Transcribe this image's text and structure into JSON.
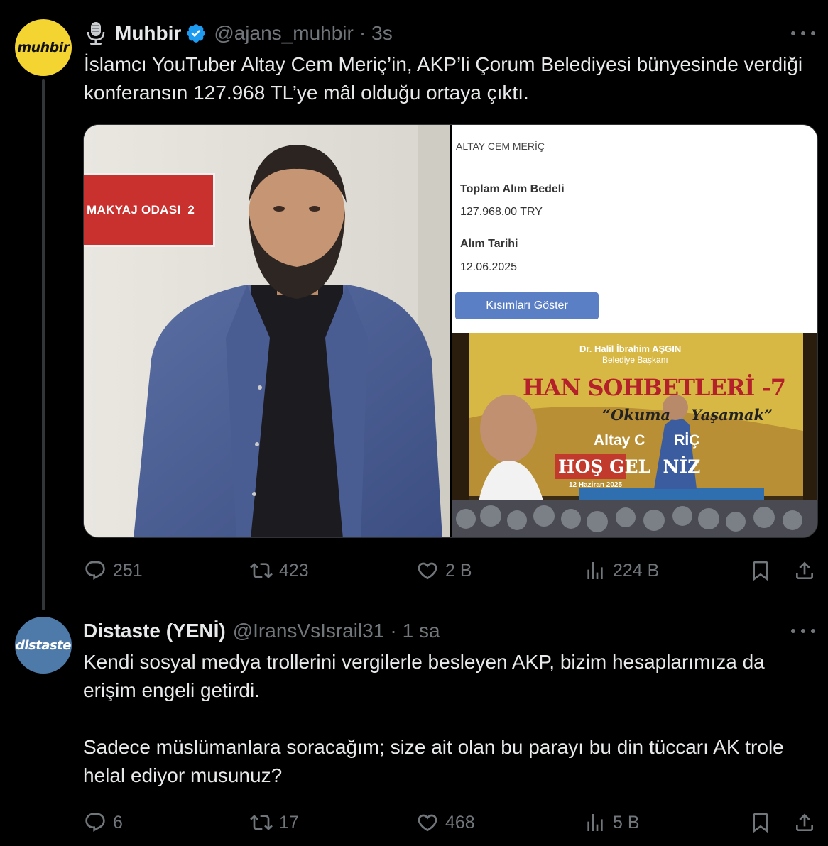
{
  "tweets": [
    {
      "avatar_text": "muhbir",
      "display_name": "Muhbir",
      "handle": "@ajans_muhbir",
      "separator": "·",
      "time": "3s",
      "text": "İslamcı YouTuber Altay Cem Meriç’in, AKP’li Çorum Belediyesi bünyesinde verdiği konferansın 127.968 TL’ye mâl olduğu ortaya çıktı.",
      "media": {
        "left_photo_sign": "MAKYAJ ODASI  2",
        "doc_header": "ALTAY CEM MERİÇ",
        "field1_label": "Toplam Alım Bedeli",
        "field1_value": "127.968,00 TRY",
        "field2_label": "Alım Tarihi",
        "field2_value": "12.06.2025",
        "button_label": "Kısımları Göster",
        "event_host": "Dr. Halil İbrahim AŞGIN",
        "event_host_title": "Belediye Başkanı",
        "event_title": "HAN SOHBETLERİ -7",
        "event_subtitle": "“Okuma    Yaşamak”",
        "event_speaker": "Altay C       RİÇ",
        "event_welcome": "HOŞ GEL  NİZ",
        "event_date": "12 Haziran 2025"
      },
      "stats": {
        "replies": "251",
        "reposts": "423",
        "likes": "2 B",
        "views": "224 B"
      }
    },
    {
      "avatar_text": "distaste",
      "display_name": "Distaste (YENİ)",
      "handle": "@IransVsIsrail31",
      "separator": "·",
      "time": "1 sa",
      "text": "Kendi sosyal medya trollerini vergilerle besleyen AKP, bizim hesaplarımıza da erişim engeli getirdi.\n\nSadece müslümanlara soracağım; size ait olan bu parayı bu din tüccarı AK trole helal ediyor musunuz?",
      "stats": {
        "replies": "6",
        "reposts": "17",
        "likes": "468",
        "views": "5 B"
      }
    }
  ],
  "colors": {
    "background": "#000000",
    "text": "#e7e9ea",
    "muted": "#71767b",
    "verified": "#1d9bf0",
    "muhbir_avatar": "#f3d431",
    "distaste_avatar": "#4d7aa8"
  },
  "icons": [
    "microphone-icon",
    "verified-badge-icon",
    "more-icon",
    "reply-icon",
    "repost-icon",
    "like-icon",
    "views-icon",
    "bookmark-icon",
    "share-icon"
  ]
}
